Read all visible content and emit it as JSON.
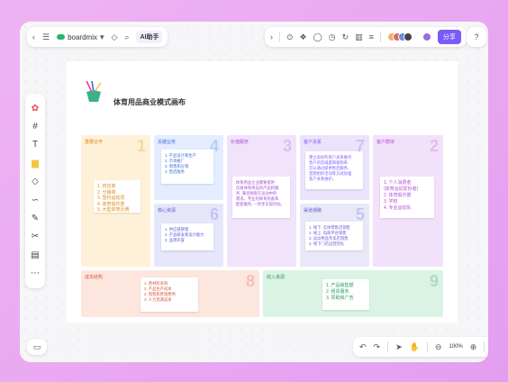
{
  "app": {
    "brand": "boardmix",
    "ai_label": "AI助手",
    "share_label": "分享",
    "zoom": "100%"
  },
  "canvas": {
    "title": "体育用品商业模式画布"
  },
  "blocks": [
    {
      "label": "重要合作",
      "num": "1",
      "notes": [
        "1. 供应商",
        "2. 分销商",
        "3. 签约运动员",
        "4. 体育俱乐部",
        "5. 大型体育比赛"
      ]
    },
    {
      "label": "关键业务",
      "num": "4",
      "notes": [
        "1. 产品设计和生产",
        "2. 市场推广",
        "3. 销售和分销",
        "4. 售后服务"
      ]
    },
    {
      "label": "核心资源",
      "num": "6",
      "notes": [
        "1. 供应链管理",
        "2. 产品研发和设计能力",
        "3. 品牌声誉"
      ]
    },
    {
      "label": "价值服务",
      "num": "3",
      "notes": [
        "体育用品企业需要提供",
        "优质体育用品的产品和服",
        "务, 满足顾客在运动中的",
        "需求。专业的体育装备和",
        "配套服务, 一步步实现目标。"
      ]
    },
    {
      "label": "客户关系",
      "num": "7",
      "notes": [
        "建立良好的客户关系维持",
        "客户的忠诚度和复购率,",
        "可以通过提供售后服务、",
        "定期组织活动等方式加强",
        "客户关系维护。"
      ]
    },
    {
      "label": "渠道通路",
      "num": "5",
      "notes": [
        "1. 线下: 实体零售店销售",
        "2. 线上: 电商平台销售",
        "3. 运动用品专卖店销售",
        "4. 线下门店运营团队"
      ]
    },
    {
      "label": "客户群体",
      "num": "2",
      "notes": [
        "1. 个人消费者",
        "   (体育运动爱好者)",
        "2. 体育俱乐部",
        "3. 学校",
        "4. 专业运动队"
      ]
    },
    {
      "label": "成本结构",
      "num": "8",
      "notes": [
        "1. 原材料采购",
        "2. 产品生产成本",
        "3. 销售和营销费用",
        "4. 人力资源成本"
      ]
    },
    {
      "label": "收入来源",
      "num": "9",
      "notes": [
        "1. 产品销售额",
        "2. 租赁服务",
        "3. 赞助和广告"
      ]
    }
  ],
  "colors": {
    "accent": "#7a5af8",
    "border": "#e7a6ee"
  }
}
